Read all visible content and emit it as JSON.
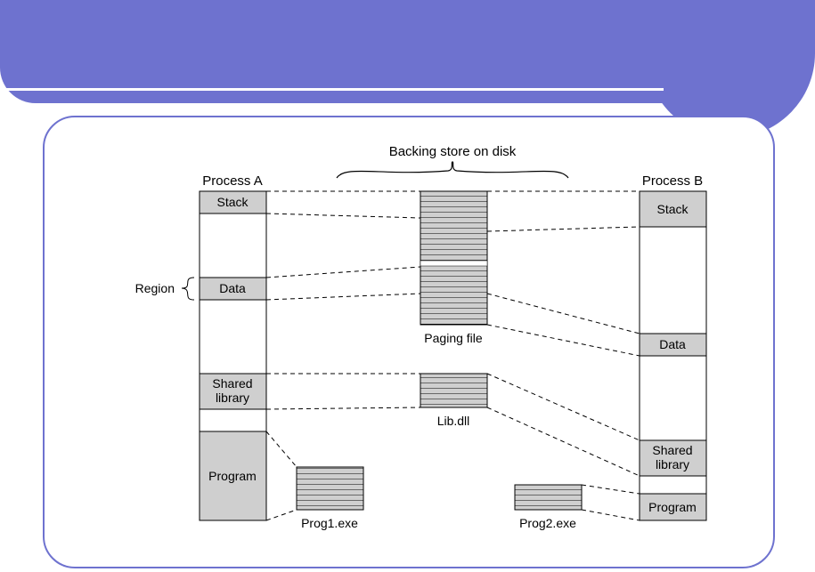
{
  "header": {
    "title_top": "Backing store on disk"
  },
  "processA": {
    "title": "Process A",
    "regionLabel": "Region",
    "segments": {
      "stack": "Stack",
      "data": "Data",
      "shared1": "Shared",
      "shared2": "library",
      "program": "Program"
    }
  },
  "processB": {
    "title": "Process B",
    "segments": {
      "stack": "Stack",
      "data": "Data",
      "shared1": "Shared",
      "shared2": "library",
      "program": "Program"
    }
  },
  "files": {
    "paging": "Paging file",
    "lib": "Lib.dll",
    "prog1": "Prog1.exe",
    "prog2": "Prog2.exe"
  }
}
